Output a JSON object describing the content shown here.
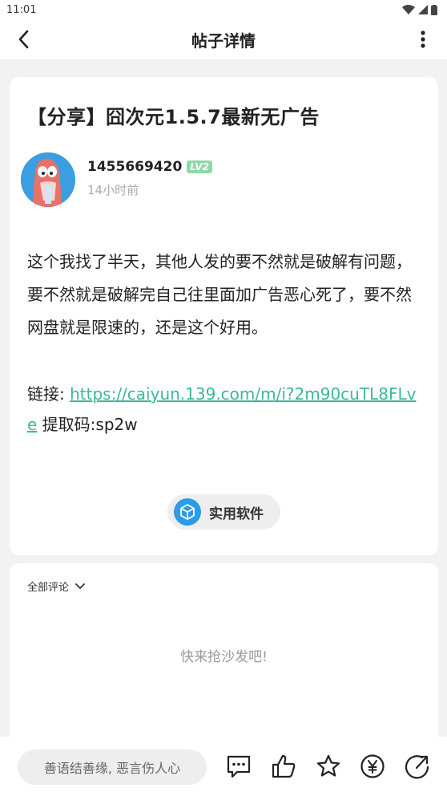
{
  "status": {
    "time": "11:01"
  },
  "header": {
    "title": "帖子详情"
  },
  "post": {
    "title": "【分享】囧次元1.5.7最新无广告",
    "author": "1455669420",
    "level": "LV2",
    "time": "14小时前",
    "body": "这个我找了半天，其他人发的要不然就是破解有问题，要不然就是破解完自己往里面加广告恶心死了，要不然网盘就是限速的，还是这个好用。",
    "link_prefix": "链接: ",
    "link_url": "https://caiyun.139.com/m/i?2m90cuTL8FLve",
    "code_text": " 提取码:sp2w",
    "tag": "实用软件"
  },
  "comments": {
    "filter_label": "全部评论",
    "empty_text": "快来抢沙发吧!"
  },
  "bottombar": {
    "input_placeholder": "善语结善缘, 恶言伤人心"
  },
  "colors": {
    "accent_link": "#3cb89a",
    "tag_icon": "#2a9ce8",
    "level_badge": "#8fd9a8"
  }
}
